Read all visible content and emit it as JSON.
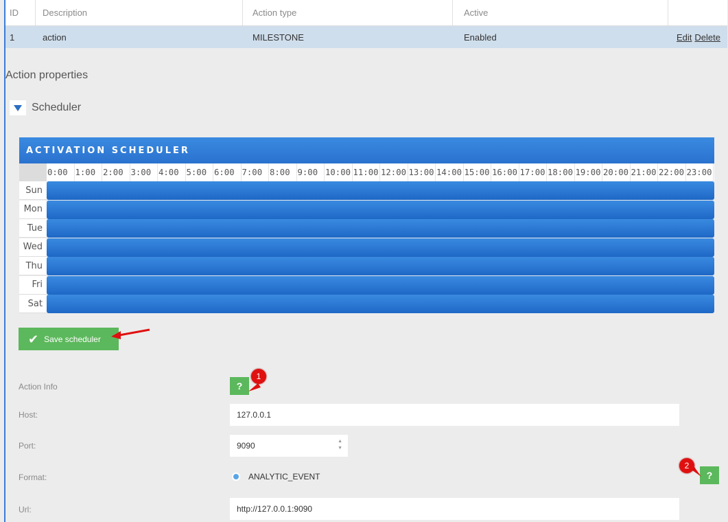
{
  "table": {
    "headers": {
      "id": "ID",
      "description": "Description",
      "action_type": "Action type",
      "active": "Active"
    },
    "row": {
      "id": "1",
      "description": "action",
      "action_type": "MILESTONE",
      "active": "Enabled",
      "edit": "Edit",
      "delete": "Delete"
    }
  },
  "section_title": "Action properties",
  "scheduler_toggle": "Scheduler",
  "scheduler": {
    "title": "ACTIVATION SCHEDULER",
    "hours": [
      "0:00",
      "1:00",
      "2:00",
      "3:00",
      "4:00",
      "5:00",
      "6:00",
      "7:00",
      "8:00",
      "9:00",
      "10:00",
      "11:00",
      "12:00",
      "13:00",
      "14:00",
      "15:00",
      "16:00",
      "17:00",
      "18:00",
      "19:00",
      "20:00",
      "21:00",
      "22:00",
      "23:00"
    ],
    "days": [
      "Sun",
      "Mon",
      "Tue",
      "Wed",
      "Thu",
      "Fri",
      "Sat"
    ],
    "bar_color": "#2a72cf"
  },
  "save_button": "Save scheduler",
  "form": {
    "action_info_label": "Action Info",
    "help_text": "?",
    "host_label": "Host:",
    "host_value": "127.0.0.1",
    "port_label": "Port:",
    "port_value": "9090",
    "format_label": "Format:",
    "format_option": "ANALYTIC_EVENT",
    "url_label": "Url:",
    "url_value": "http://127.0.0.1:9090"
  },
  "annotations": {
    "badge1": "1",
    "badge2": "2",
    "color": "#e01010"
  }
}
